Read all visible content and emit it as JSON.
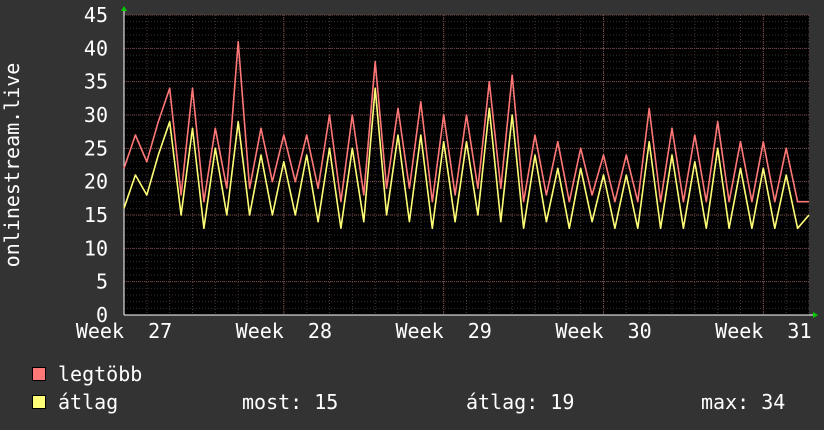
{
  "chart_data": {
    "type": "line",
    "title": "",
    "ylabel": "onlinestream.live",
    "xlabel": "",
    "ylim": [
      0,
      45
    ],
    "yticks": [
      0,
      5,
      10,
      15,
      20,
      25,
      30,
      35,
      40,
      45
    ],
    "xlim": [
      0,
      30
    ],
    "xticks": [
      {
        "label": "Week  27",
        "x": 0
      },
      {
        "label": "Week  28",
        "x": 7
      },
      {
        "label": "Week  29",
        "x": 14
      },
      {
        "label": "Week  30",
        "x": 21
      },
      {
        "label": "Week  31",
        "x": 28
      }
    ],
    "grid": true,
    "series": [
      {
        "name": "legtöbb",
        "color": "#ff7777",
        "x": [
          0,
          0.5,
          1,
          1.5,
          2,
          2.5,
          3,
          3.5,
          4,
          4.5,
          5,
          5.5,
          6,
          6.5,
          7,
          7.5,
          8,
          8.5,
          9,
          9.5,
          10,
          10.5,
          11,
          11.5,
          12,
          12.5,
          13,
          13.5,
          14,
          14.5,
          15,
          15.5,
          16,
          16.5,
          17,
          17.5,
          18,
          18.5,
          19,
          19.5,
          20,
          20.5,
          21,
          21.5,
          22,
          22.5,
          23,
          23.5,
          24,
          24.5,
          25,
          25.5,
          26,
          26.5,
          27,
          27.5,
          28,
          28.5,
          29,
          29.5,
          30
        ],
        "values": [
          22,
          27,
          23,
          29,
          34,
          18,
          34,
          17,
          28,
          19,
          41,
          19,
          28,
          20,
          27,
          20,
          27,
          19,
          30,
          17,
          30,
          18,
          38,
          19,
          31,
          19,
          32,
          17,
          30,
          18,
          30,
          19,
          35,
          19,
          36,
          17,
          27,
          18,
          26,
          17,
          25,
          18,
          24,
          17,
          24,
          17,
          31,
          17,
          28,
          17,
          27,
          17,
          29,
          17,
          26,
          17,
          26,
          17,
          25,
          17,
          17
        ]
      },
      {
        "name": "átlag",
        "color": "#ffff77",
        "x": [
          0,
          0.5,
          1,
          1.5,
          2,
          2.5,
          3,
          3.5,
          4,
          4.5,
          5,
          5.5,
          6,
          6.5,
          7,
          7.5,
          8,
          8.5,
          9,
          9.5,
          10,
          10.5,
          11,
          11.5,
          12,
          12.5,
          13,
          13.5,
          14,
          14.5,
          15,
          15.5,
          16,
          16.5,
          17,
          17.5,
          18,
          18.5,
          19,
          19.5,
          20,
          20.5,
          21,
          21.5,
          22,
          22.5,
          23,
          23.5,
          24,
          24.5,
          25,
          25.5,
          26,
          26.5,
          27,
          27.5,
          28,
          28.5,
          29,
          29.5,
          30
        ],
        "values": [
          16,
          21,
          18,
          24,
          29,
          15,
          28,
          13,
          25,
          15,
          29,
          15,
          24,
          15,
          23,
          15,
          24,
          14,
          25,
          13,
          25,
          14,
          34,
          15,
          27,
          14,
          27,
          13,
          26,
          14,
          26,
          15,
          31,
          14,
          30,
          13,
          24,
          14,
          22,
          13,
          22,
          14,
          21,
          13,
          21,
          13,
          26,
          13,
          24,
          13,
          23,
          13,
          25,
          13,
          22,
          13,
          22,
          13,
          21,
          13,
          15
        ]
      }
    ]
  },
  "legend": [
    {
      "label": "legtöbb",
      "color": "#ff7777"
    },
    {
      "label": "átlag",
      "color": "#ffff77"
    }
  ],
  "stats": {
    "now": "most: 15",
    "avg": "átlag: 19",
    "max": "max: 34"
  }
}
